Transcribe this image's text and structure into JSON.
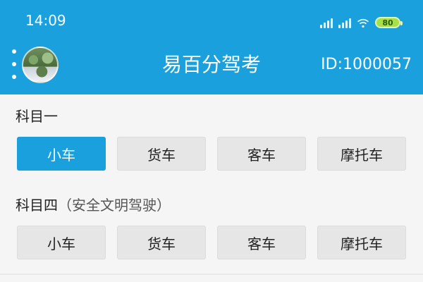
{
  "status_bar": {
    "time": "14:09",
    "battery": "80",
    "icons": [
      "signal-icon",
      "signal-icon",
      "wifi-icon",
      "battery-icon"
    ]
  },
  "header": {
    "menu_icon": "more-vertical-icon",
    "title": "易百分驾考",
    "user_id": "ID:1000057",
    "background": "#1aa0dc"
  },
  "sections": [
    {
      "title": "科目一",
      "subtitle": "",
      "buttons": [
        {
          "label": "小车",
          "selected": true
        },
        {
          "label": "货车",
          "selected": false
        },
        {
          "label": "客车",
          "selected": false
        },
        {
          "label": "摩托车",
          "selected": false
        }
      ]
    },
    {
      "title": "科目四",
      "subtitle": "（安全文明驾驶）",
      "buttons": [
        {
          "label": "小车",
          "selected": false
        },
        {
          "label": "货车",
          "selected": false
        },
        {
          "label": "客车",
          "selected": false
        },
        {
          "label": "摩托车",
          "selected": false
        }
      ]
    }
  ],
  "colors": {
    "accent": "#1aa0dc",
    "button_bg": "#e6e6e6",
    "page_bg": "#f5f5f5"
  }
}
